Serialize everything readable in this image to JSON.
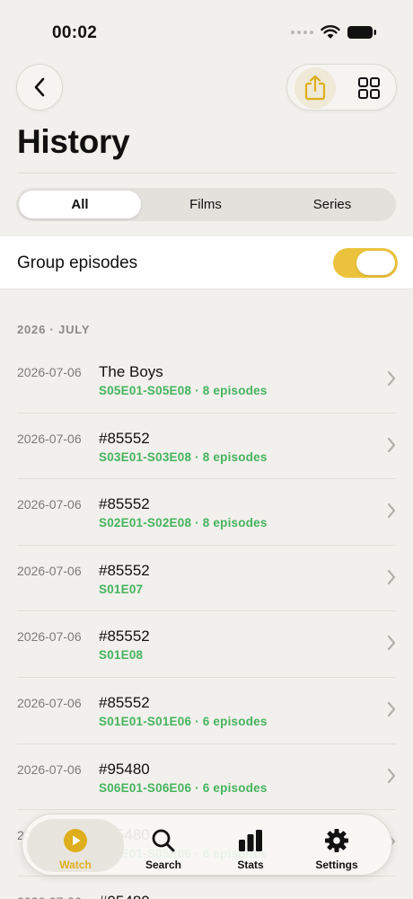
{
  "status_bar": {
    "time": "00:02"
  },
  "header": {
    "title": "History"
  },
  "filter": {
    "tabs": [
      "All",
      "Films",
      "Series"
    ],
    "selected": "All"
  },
  "group_episodes": {
    "label": "Group episodes",
    "enabled": true
  },
  "section": {
    "label": "2026 · JULY"
  },
  "items": [
    {
      "date": "2026-07-06",
      "title": "The Boys",
      "subtitle": "S05E01-S05E08 · 8 episodes"
    },
    {
      "date": "2026-07-06",
      "title": "#85552",
      "subtitle": "S03E01-S03E08 · 8 episodes"
    },
    {
      "date": "2026-07-06",
      "title": "#85552",
      "subtitle": "S02E01-S02E08 · 8 episodes"
    },
    {
      "date": "2026-07-06",
      "title": "#85552",
      "subtitle": "S01E07"
    },
    {
      "date": "2026-07-06",
      "title": "#85552",
      "subtitle": "S01E08"
    },
    {
      "date": "2026-07-06",
      "title": "#85552",
      "subtitle": "S01E01-S01E06 · 6 episodes"
    },
    {
      "date": "2026-07-06",
      "title": "#95480",
      "subtitle": "S06E01-S06E06 · 6 episodes"
    },
    {
      "date": "2026-07-06",
      "title": "#95480",
      "subtitle": "S05E01-S05E06 · 6 episodes"
    },
    {
      "date": "2026-07-06",
      "title": "#95480",
      "subtitle": ""
    }
  ],
  "tab_bar": {
    "tabs": [
      {
        "label": "Watch",
        "icon": "play-circle-icon"
      },
      {
        "label": "Search",
        "icon": "search-icon"
      },
      {
        "label": "Stats",
        "icon": "bar-chart-icon"
      },
      {
        "label": "Settings",
        "icon": "gear-icon"
      }
    ],
    "active": "Watch"
  },
  "colors": {
    "accent": "#ebc23b",
    "episode_text": "#46b35e",
    "background": "#f2f0ec"
  }
}
